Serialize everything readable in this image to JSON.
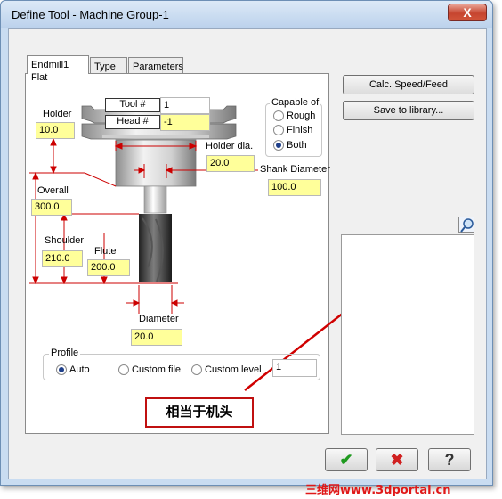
{
  "window": {
    "title": "Define Tool - Machine Group-1",
    "close_label": "X"
  },
  "tabs": [
    {
      "label": "Endmill1 Flat"
    },
    {
      "label": "Type"
    },
    {
      "label": "Parameters"
    }
  ],
  "tool": {
    "tool_num_label": "Tool #",
    "tool_num_value": "1",
    "head_num_label": "Head #",
    "head_num_value": "-1",
    "holder_label": "Holder",
    "holder_value": "10.0",
    "holder_dia_label": "Holder dia.",
    "holder_dia_value": "20.0",
    "shank_label": "Shank Diameter",
    "shank_value": "100.0",
    "overall_label": "Overall",
    "overall_value": "300.0",
    "shoulder_label": "Shoulder",
    "shoulder_value": "210.0",
    "flute_label": "Flute",
    "flute_value": "200.0",
    "diameter_label": "Diameter",
    "diameter_value": "20.0"
  },
  "capable": {
    "title": "Capable of",
    "options": [
      "Rough",
      "Finish",
      "Both"
    ],
    "selected": "Both"
  },
  "profile": {
    "title": "Profile",
    "options": [
      "Auto",
      "Custom file",
      "Custom level"
    ],
    "selected": "Auto",
    "level_value": "1"
  },
  "buttons": {
    "calc": "Calc. Speed/Feed",
    "save": "Save to library..."
  },
  "footer": {
    "ok": "✔",
    "cancel": "✖",
    "help": "?"
  },
  "annotation": {
    "text": "相当于机头"
  },
  "watermark": {
    "text": "三维网www.3dportal.cn"
  }
}
